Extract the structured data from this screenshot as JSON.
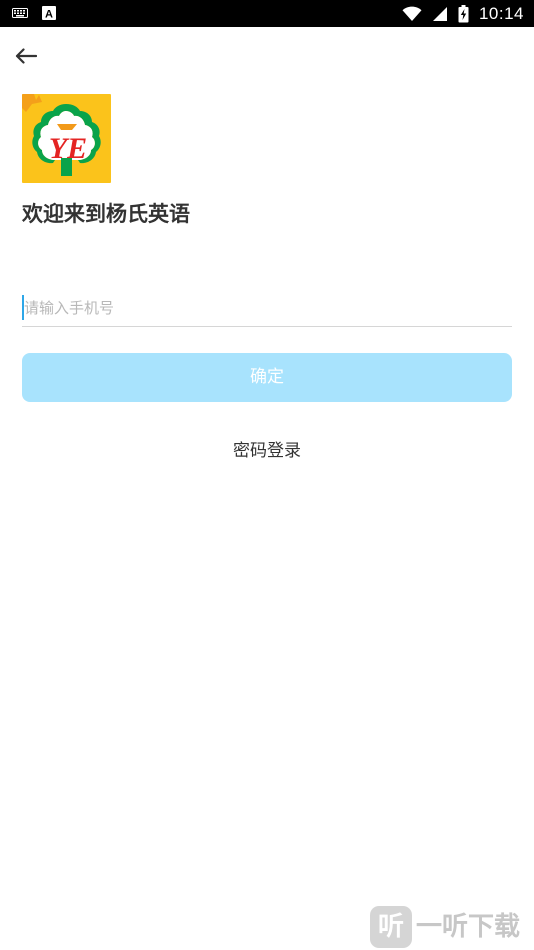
{
  "status_bar": {
    "time": "10:14",
    "icons": [
      "keyboard-icon",
      "font-a-icon",
      "wifi-icon",
      "signal-icon",
      "battery-charging-icon"
    ],
    "left_badge_letter": "A"
  },
  "nav": {
    "back_icon": "arrow-left-icon"
  },
  "logo": {
    "letters": "YE",
    "colors": {
      "background": "#fbc31b",
      "tree_green": "#0aa34a",
      "text_red": "#e42423"
    }
  },
  "welcome": {
    "title": "欢迎来到杨氏英语"
  },
  "form": {
    "phone_placeholder": "请输入手机号",
    "phone_value": "",
    "confirm_label": "确定",
    "password_login_label": "密码登录"
  },
  "watermark": {
    "badge": "听",
    "text": "一听下载"
  },
  "theme": {
    "accent": "#2ea7e8",
    "button_disabled": "#a8e3fd",
    "text_primary": "#333333"
  }
}
